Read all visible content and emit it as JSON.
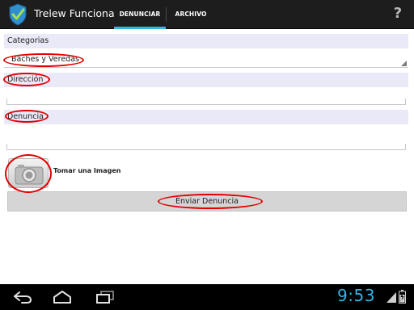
{
  "action_bar": {
    "title": "Trelew Funciona",
    "tabs": [
      {
        "label": "DENUNCIAR",
        "selected": true
      },
      {
        "label": "ARCHIVO",
        "selected": false
      }
    ],
    "help_label": "?",
    "background": "#1d1d1d",
    "accent": "#33b5e5"
  },
  "form": {
    "categorias_label": "Categorias",
    "categoria_selected": "Baches y Veredas",
    "direccion_label": "Dirección",
    "direccion_value": "",
    "denuncia_label": "Denuncia",
    "denuncia_value": "",
    "camera_label": "Tomar una Imagen",
    "submit_label": "Enviar Denuncia"
  },
  "annotations": {
    "color": "#e30000",
    "count": 5
  },
  "system_bar": {
    "time": "9:53",
    "time_color": "#33b5e5",
    "icons": [
      "back-icon",
      "home-icon",
      "recent-apps-icon",
      "signal-icon",
      "battery-icon"
    ]
  }
}
